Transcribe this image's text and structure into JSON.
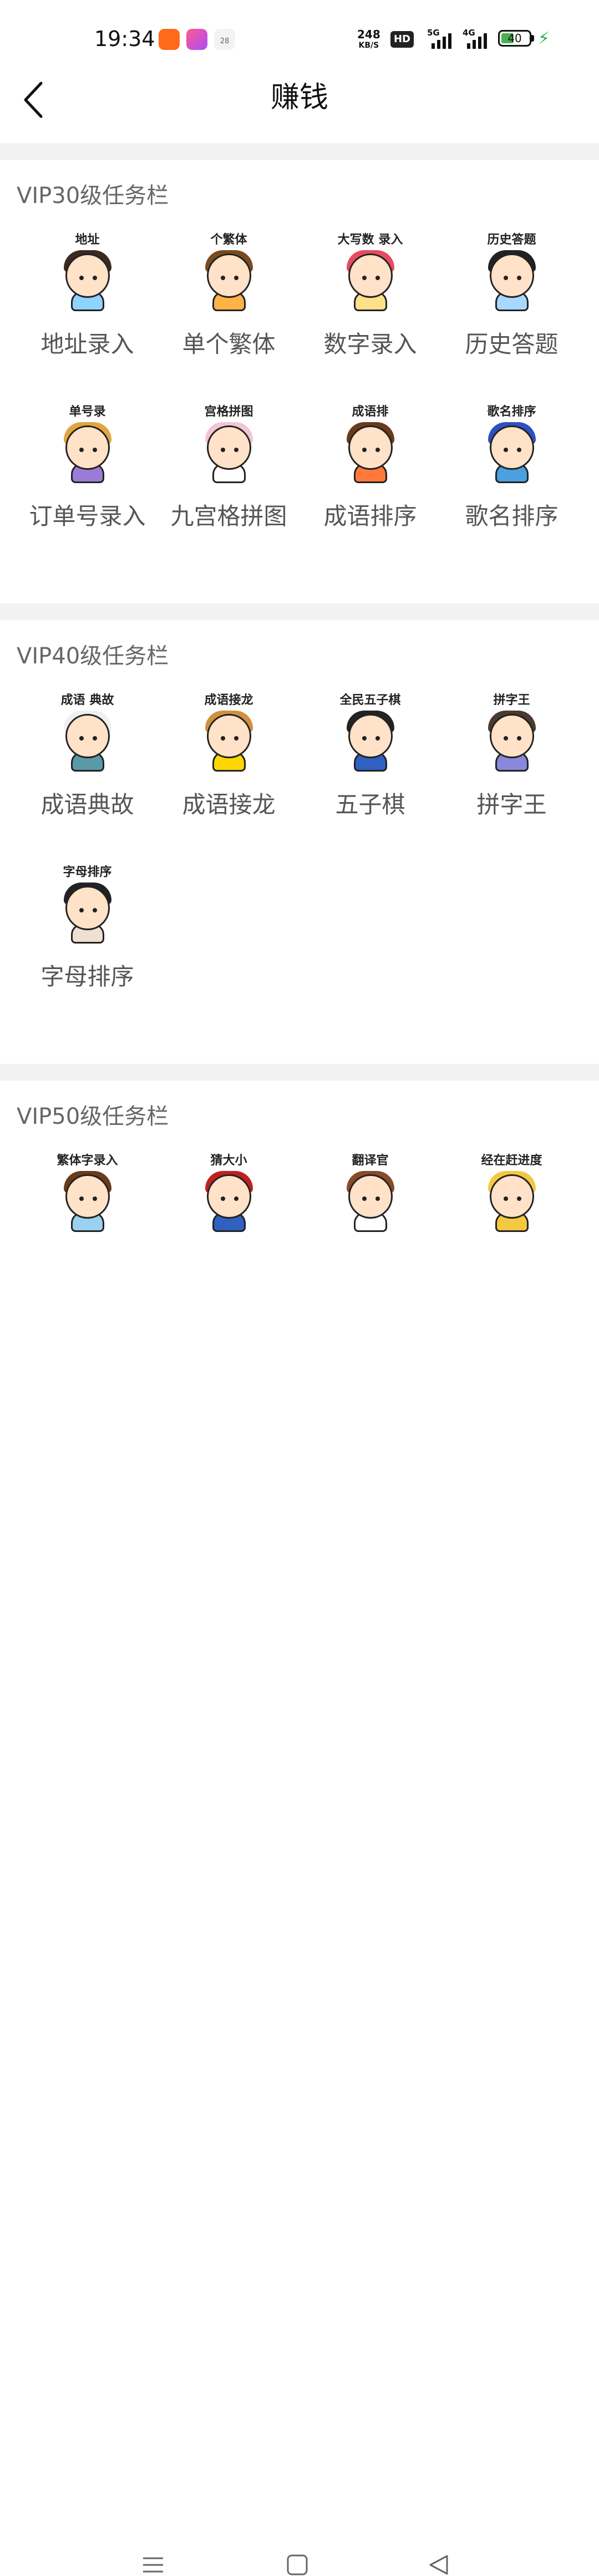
{
  "status": {
    "time": "19:34",
    "calendar_day": "28",
    "net_speed": "248",
    "net_unit": "KB/S",
    "hd": "HD",
    "sig1": "5G",
    "sig2": "4G",
    "battery": "40"
  },
  "header": {
    "title": "赚钱"
  },
  "sections": [
    {
      "title": "VIP30级任务栏",
      "items": [
        {
          "label": "地址录入",
          "tag": "地址",
          "hair": "#3a2a20",
          "shirt": "#8fd3ff"
        },
        {
          "label": "单个繁体",
          "tag": "个繁体",
          "hair": "#7a4a20",
          "shirt": "#ffb347"
        },
        {
          "label": "数字录入",
          "tag": "大写数 录入",
          "hair": "#e84a5f",
          "shirt": "#ffe08a"
        },
        {
          "label": "历史答题",
          "tag": "历史答题",
          "hair": "#222222",
          "shirt": "#a8d8ff"
        },
        {
          "label": "订单号录入",
          "tag": "单号录",
          "hair": "#e0a640",
          "shirt": "#9b7bd8"
        },
        {
          "label": "九宫格拼图",
          "tag": "宫格拼图",
          "hair": "#f4c4d4",
          "shirt": "#ffffff"
        },
        {
          "label": "成语排序",
          "tag": "成语排",
          "hair": "#6b3a1a",
          "shirt": "#ff7a3a"
        },
        {
          "label": "歌名排序",
          "tag": "歌名排序",
          "hair": "#3050c0",
          "shirt": "#4aa0e0"
        }
      ]
    },
    {
      "title": "VIP40级任务栏",
      "items": [
        {
          "label": "成语典故",
          "tag": "成语 典故",
          "hair": "#f0f0f0",
          "shirt": "#5a9aa8"
        },
        {
          "label": "成语接龙",
          "tag": "成语接龙",
          "hair": "#d09040",
          "shirt": "#ffd700"
        },
        {
          "label": "五子棋",
          "tag": "全民五子棋",
          "hair": "#222222",
          "shirt": "#3060c0"
        },
        {
          "label": "拼字王",
          "tag": "拼字王",
          "hair": "#4a3a30",
          "shirt": "#8888dd"
        },
        {
          "label": "字母排序",
          "tag": "字母排序",
          "hair": "#222222",
          "shirt": "#f0e0d0"
        }
      ]
    },
    {
      "title": "VIP50级任务栏",
      "items": [
        {
          "label": "",
          "tag": "繁体字录入",
          "hair": "#6b3a1a",
          "shirt": "#9ad0f0"
        },
        {
          "label": "",
          "tag": "猜大小",
          "hair": "#c02020",
          "shirt": "#3060c0"
        },
        {
          "label": "",
          "tag": "翻译官",
          "hair": "#8a4a2a",
          "shirt": "#ffffff"
        },
        {
          "label": "",
          "tag": "经在赶进度",
          "hair": "#f5c842",
          "shirt": "#f5c842"
        }
      ]
    }
  ],
  "bottom_nav": {
    "menu": "menu-icon",
    "home": "home-icon",
    "back": "back-icon"
  }
}
